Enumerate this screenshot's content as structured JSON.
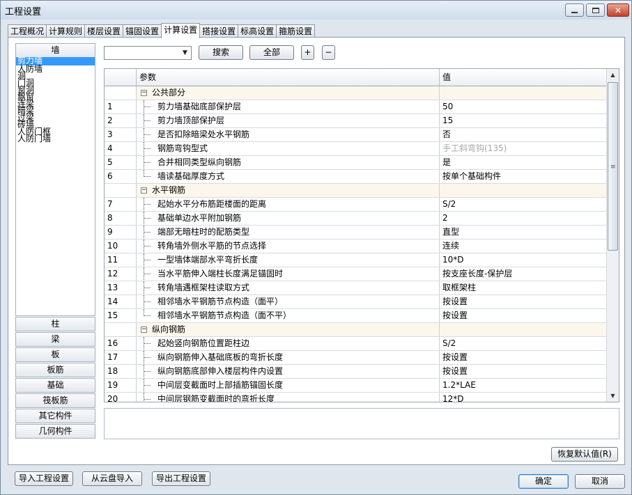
{
  "window": {
    "title": "工程设置"
  },
  "tabs": [
    {
      "label": "工程概况",
      "active": false
    },
    {
      "label": "计算规则",
      "active": false
    },
    {
      "label": "楼层设置",
      "active": false
    },
    {
      "label": "锚固设置",
      "active": false
    },
    {
      "label": "计算设置",
      "active": true
    },
    {
      "label": "搭接设置",
      "active": false
    },
    {
      "label": "标高设置",
      "active": false
    },
    {
      "label": "箍筋设置",
      "active": false
    }
  ],
  "categories": {
    "header": "墙",
    "items": [
      "剪力墙",
      "人防墙",
      "洞",
      "门洞",
      "窗洞",
      "飘窗",
      "连梁",
      "暗梁",
      "过梁",
      "砖墙",
      "人防门框",
      "人防门墙"
    ],
    "selected_index": 0,
    "buttons": [
      "柱",
      "梁",
      "板",
      "板筋",
      "基础",
      "筏板筋",
      "其它构件",
      "几何构件"
    ]
  },
  "toolbar": {
    "combo_value": "",
    "search_label": "搜索",
    "all_label": "全部",
    "expand_label": "+",
    "collapse_label": "−"
  },
  "grid": {
    "col_param": "参数",
    "col_value": "值",
    "rows": [
      {
        "num": "",
        "param": "公共部分",
        "value": "",
        "group": true
      },
      {
        "num": "1",
        "param": "剪力墙基础底部保护层",
        "value": "50"
      },
      {
        "num": "2",
        "param": "剪力墙顶部保护层",
        "value": "15"
      },
      {
        "num": "3",
        "param": "是否扣除暗梁处水平钢筋",
        "value": "否"
      },
      {
        "num": "4",
        "param": "钢筋弯钩型式",
        "value": "手工斜弯钩(135)",
        "disabled": true
      },
      {
        "num": "5",
        "param": "合并相同类型纵向钢筋",
        "value": "是"
      },
      {
        "num": "6",
        "param": "墙读基础厚度方式",
        "value": "按单个基础构件",
        "last": true
      },
      {
        "num": "",
        "param": "水平钢筋",
        "value": "",
        "group": true
      },
      {
        "num": "7",
        "param": "起始水平分布筋距楼面的距离",
        "value": "S/2"
      },
      {
        "num": "8",
        "param": "基础单边水平附加钢筋",
        "value": "2"
      },
      {
        "num": "9",
        "param": "端部无暗柱时的配筋类型",
        "value": "直型"
      },
      {
        "num": "10",
        "param": "转角墙外侧水平筋的节点选择",
        "value": "连续"
      },
      {
        "num": "11",
        "param": "一型墙体端部水平弯折长度",
        "value": "10*D"
      },
      {
        "num": "12",
        "param": "当水平筋伸入端柱长度满足锚固时",
        "value": "按支座长度-保护层"
      },
      {
        "num": "13",
        "param": "转角墙遇框架柱读取方式",
        "value": "取框架柱"
      },
      {
        "num": "14",
        "param": "相邻墙水平钢筋节点构造（面平）",
        "value": "按设置"
      },
      {
        "num": "15",
        "param": "相邻墙水平钢筋节点构造（面不平）",
        "value": "按设置",
        "last": true
      },
      {
        "num": "",
        "param": "纵向钢筋",
        "value": "",
        "group": true
      },
      {
        "num": "16",
        "param": "起始竖向钢筋位置距柱边",
        "value": "S/2"
      },
      {
        "num": "17",
        "param": "纵向钢筋伸入基础底板的弯折长度",
        "value": "按设置"
      },
      {
        "num": "18",
        "param": "纵向钢筋底部伸入楼层构件内设置",
        "value": "按设置"
      },
      {
        "num": "19",
        "param": "中间层变截面时上部插筋锚固长度",
        "value": "1.2*LAE"
      },
      {
        "num": "20",
        "param": "中间层钢筋变截面时的弯折长度",
        "value": "12*D"
      }
    ]
  },
  "footer": {
    "restore_label": "恢复默认值(R)",
    "import_label": "导入工程设置",
    "cloud_import_label": "从云盘导入",
    "export_label": "导出工程设置",
    "ok_label": "确定",
    "cancel_label": "取消"
  }
}
